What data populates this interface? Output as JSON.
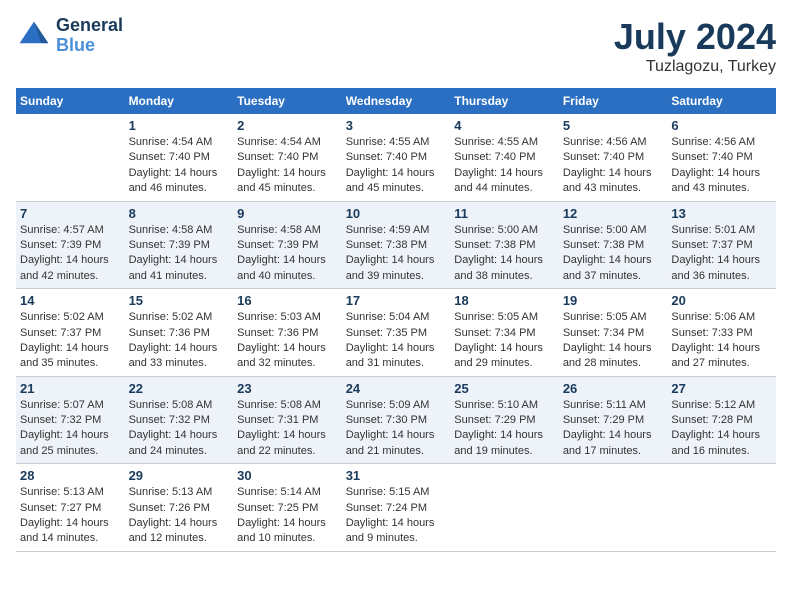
{
  "logo": {
    "line1": "General",
    "line2": "Blue"
  },
  "title": "July 2024",
  "location": "Tuzlagozu, Turkey",
  "days_of_week": [
    "Sunday",
    "Monday",
    "Tuesday",
    "Wednesday",
    "Thursday",
    "Friday",
    "Saturday"
  ],
  "weeks": [
    [
      {
        "day": "",
        "lines": []
      },
      {
        "day": "1",
        "lines": [
          "Sunrise: 4:54 AM",
          "Sunset: 7:40 PM",
          "Daylight: 14 hours",
          "and 46 minutes."
        ]
      },
      {
        "day": "2",
        "lines": [
          "Sunrise: 4:54 AM",
          "Sunset: 7:40 PM",
          "Daylight: 14 hours",
          "and 45 minutes."
        ]
      },
      {
        "day": "3",
        "lines": [
          "Sunrise: 4:55 AM",
          "Sunset: 7:40 PM",
          "Daylight: 14 hours",
          "and 45 minutes."
        ]
      },
      {
        "day": "4",
        "lines": [
          "Sunrise: 4:55 AM",
          "Sunset: 7:40 PM",
          "Daylight: 14 hours",
          "and 44 minutes."
        ]
      },
      {
        "day": "5",
        "lines": [
          "Sunrise: 4:56 AM",
          "Sunset: 7:40 PM",
          "Daylight: 14 hours",
          "and 43 minutes."
        ]
      },
      {
        "day": "6",
        "lines": [
          "Sunrise: 4:56 AM",
          "Sunset: 7:40 PM",
          "Daylight: 14 hours",
          "and 43 minutes."
        ]
      }
    ],
    [
      {
        "day": "7",
        "lines": [
          "Sunrise: 4:57 AM",
          "Sunset: 7:39 PM",
          "Daylight: 14 hours",
          "and 42 minutes."
        ]
      },
      {
        "day": "8",
        "lines": [
          "Sunrise: 4:58 AM",
          "Sunset: 7:39 PM",
          "Daylight: 14 hours",
          "and 41 minutes."
        ]
      },
      {
        "day": "9",
        "lines": [
          "Sunrise: 4:58 AM",
          "Sunset: 7:39 PM",
          "Daylight: 14 hours",
          "and 40 minutes."
        ]
      },
      {
        "day": "10",
        "lines": [
          "Sunrise: 4:59 AM",
          "Sunset: 7:38 PM",
          "Daylight: 14 hours",
          "and 39 minutes."
        ]
      },
      {
        "day": "11",
        "lines": [
          "Sunrise: 5:00 AM",
          "Sunset: 7:38 PM",
          "Daylight: 14 hours",
          "and 38 minutes."
        ]
      },
      {
        "day": "12",
        "lines": [
          "Sunrise: 5:00 AM",
          "Sunset: 7:38 PM",
          "Daylight: 14 hours",
          "and 37 minutes."
        ]
      },
      {
        "day": "13",
        "lines": [
          "Sunrise: 5:01 AM",
          "Sunset: 7:37 PM",
          "Daylight: 14 hours",
          "and 36 minutes."
        ]
      }
    ],
    [
      {
        "day": "14",
        "lines": [
          "Sunrise: 5:02 AM",
          "Sunset: 7:37 PM",
          "Daylight: 14 hours",
          "and 35 minutes."
        ]
      },
      {
        "day": "15",
        "lines": [
          "Sunrise: 5:02 AM",
          "Sunset: 7:36 PM",
          "Daylight: 14 hours",
          "and 33 minutes."
        ]
      },
      {
        "day": "16",
        "lines": [
          "Sunrise: 5:03 AM",
          "Sunset: 7:36 PM",
          "Daylight: 14 hours",
          "and 32 minutes."
        ]
      },
      {
        "day": "17",
        "lines": [
          "Sunrise: 5:04 AM",
          "Sunset: 7:35 PM",
          "Daylight: 14 hours",
          "and 31 minutes."
        ]
      },
      {
        "day": "18",
        "lines": [
          "Sunrise: 5:05 AM",
          "Sunset: 7:34 PM",
          "Daylight: 14 hours",
          "and 29 minutes."
        ]
      },
      {
        "day": "19",
        "lines": [
          "Sunrise: 5:05 AM",
          "Sunset: 7:34 PM",
          "Daylight: 14 hours",
          "and 28 minutes."
        ]
      },
      {
        "day": "20",
        "lines": [
          "Sunrise: 5:06 AM",
          "Sunset: 7:33 PM",
          "Daylight: 14 hours",
          "and 27 minutes."
        ]
      }
    ],
    [
      {
        "day": "21",
        "lines": [
          "Sunrise: 5:07 AM",
          "Sunset: 7:32 PM",
          "Daylight: 14 hours",
          "and 25 minutes."
        ]
      },
      {
        "day": "22",
        "lines": [
          "Sunrise: 5:08 AM",
          "Sunset: 7:32 PM",
          "Daylight: 14 hours",
          "and 24 minutes."
        ]
      },
      {
        "day": "23",
        "lines": [
          "Sunrise: 5:08 AM",
          "Sunset: 7:31 PM",
          "Daylight: 14 hours",
          "and 22 minutes."
        ]
      },
      {
        "day": "24",
        "lines": [
          "Sunrise: 5:09 AM",
          "Sunset: 7:30 PM",
          "Daylight: 14 hours",
          "and 21 minutes."
        ]
      },
      {
        "day": "25",
        "lines": [
          "Sunrise: 5:10 AM",
          "Sunset: 7:29 PM",
          "Daylight: 14 hours",
          "and 19 minutes."
        ]
      },
      {
        "day": "26",
        "lines": [
          "Sunrise: 5:11 AM",
          "Sunset: 7:29 PM",
          "Daylight: 14 hours",
          "and 17 minutes."
        ]
      },
      {
        "day": "27",
        "lines": [
          "Sunrise: 5:12 AM",
          "Sunset: 7:28 PM",
          "Daylight: 14 hours",
          "and 16 minutes."
        ]
      }
    ],
    [
      {
        "day": "28",
        "lines": [
          "Sunrise: 5:13 AM",
          "Sunset: 7:27 PM",
          "Daylight: 14 hours",
          "and 14 minutes."
        ]
      },
      {
        "day": "29",
        "lines": [
          "Sunrise: 5:13 AM",
          "Sunset: 7:26 PM",
          "Daylight: 14 hours",
          "and 12 minutes."
        ]
      },
      {
        "day": "30",
        "lines": [
          "Sunrise: 5:14 AM",
          "Sunset: 7:25 PM",
          "Daylight: 14 hours",
          "and 10 minutes."
        ]
      },
      {
        "day": "31",
        "lines": [
          "Sunrise: 5:15 AM",
          "Sunset: 7:24 PM",
          "Daylight: 14 hours",
          "and 9 minutes."
        ]
      },
      {
        "day": "",
        "lines": []
      },
      {
        "day": "",
        "lines": []
      },
      {
        "day": "",
        "lines": []
      }
    ]
  ]
}
